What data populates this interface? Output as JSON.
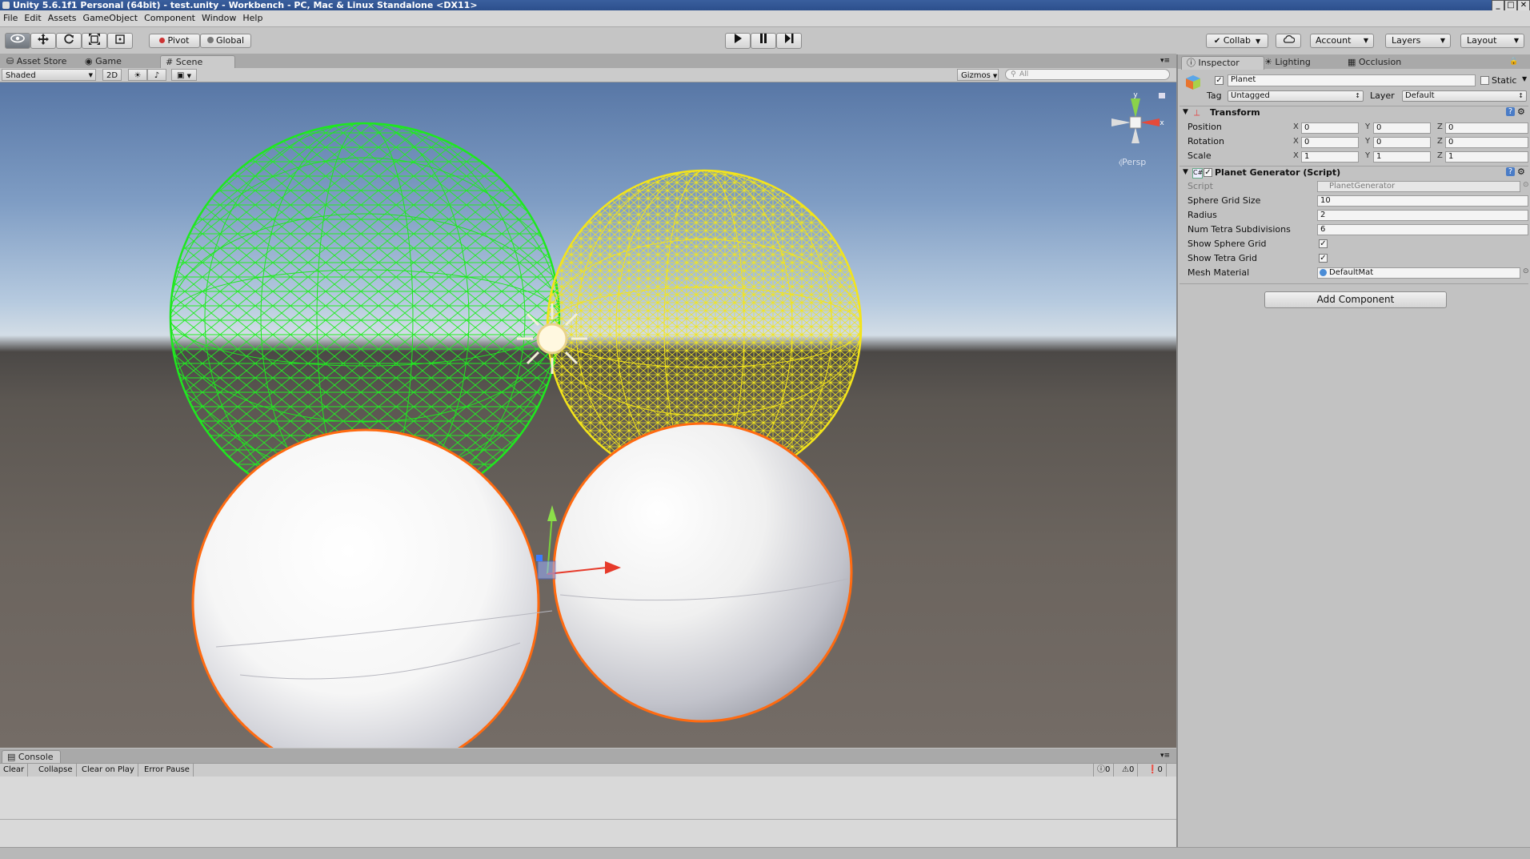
{
  "window": {
    "title": "Unity 5.6.1f1 Personal (64bit) - test.unity - Workbench - PC, Mac & Linux Standalone <DX11>",
    "controls": {
      "minimize": "_",
      "maximize": "□",
      "close": "✕"
    }
  },
  "menu": [
    "File",
    "Edit",
    "Assets",
    "GameObject",
    "Component",
    "Window",
    "Help"
  ],
  "toolbar": {
    "pivot": "Pivot",
    "global": "Global",
    "collab": "Collab",
    "account": "Account",
    "layers": "Layers",
    "layout": "Layout"
  },
  "editor_tabs": [
    "Asset Store",
    "Game",
    "Scene"
  ],
  "scene_bar": {
    "shading": "Shaded",
    "mode_2d": "2D",
    "gizmos": "Gizmos",
    "search_placeholder": "All"
  },
  "scene_view": {
    "projection": "Persp",
    "gizmo_y": "y",
    "gizmo_x": "x"
  },
  "console": {
    "tab": "Console",
    "buttons": [
      "Clear",
      "Collapse",
      "Clear on Play",
      "Error Pause"
    ],
    "counts": {
      "info": "0",
      "warnings": "0",
      "errors": "0"
    }
  },
  "inspector": {
    "tabs": [
      "Inspector",
      "Lighting",
      "Occlusion"
    ],
    "object_name": "Planet",
    "static_label": "Static",
    "tag_label": "Tag",
    "tag_value": "Untagged",
    "layer_label": "Layer",
    "layer_value": "Default",
    "transform": {
      "title": "Transform",
      "rows": [
        {
          "label": "Position",
          "x": "0",
          "y": "0",
          "z": "0"
        },
        {
          "label": "Rotation",
          "x": "0",
          "y": "0",
          "z": "0"
        },
        {
          "label": "Scale",
          "x": "1",
          "y": "1",
          "z": "1"
        }
      ]
    },
    "script_component": {
      "title": "Planet Generator (Script)",
      "script_label": "Script",
      "script_value": "PlanetGenerator",
      "sphere_grid_size_label": "Sphere Grid Size",
      "sphere_grid_size": "10",
      "radius_label": "Radius",
      "radius": "2",
      "num_tetra_label": "Num Tetra Subdivisions",
      "num_tetra": "6",
      "show_sphere_grid_label": "Show Sphere Grid",
      "show_sphere_grid": true,
      "show_tetra_grid_label": "Show Tetra Grid",
      "show_tetra_grid": true,
      "mesh_material_label": "Mesh Material",
      "mesh_material": "DefaultMat"
    },
    "add_component": "Add Component"
  }
}
